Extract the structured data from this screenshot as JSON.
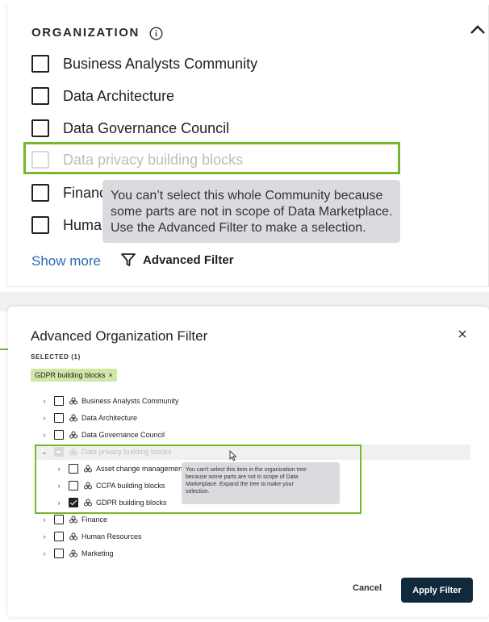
{
  "organization_panel": {
    "header": "ORGANIZATION",
    "items": [
      {
        "label": "Business Analysts Community"
      },
      {
        "label": "Data Architecture"
      },
      {
        "label": "Data Governance Council"
      },
      {
        "label": "Data privacy building blocks",
        "disabled": true
      },
      {
        "label": "Finance"
      },
      {
        "label": "Human Resources"
      }
    ],
    "tooltip_lines": [
      "You can’t select this whole Community because",
      "some parts are not in scope of Data Marketplace.",
      "Use the Advanced Filter to make a selection."
    ],
    "show_more": "Show more",
    "advanced_filter": "Advanced Filter"
  },
  "modal": {
    "title": "Advanced Organization Filter",
    "selected_label": "SELECTED (1)",
    "chip_label": "GDPR building blocks",
    "chip_close": "×",
    "close_icon": "×",
    "tree": [
      {
        "label": "Business Analysts Community",
        "caret": ">",
        "checked": false
      },
      {
        "label": "Data Architecture",
        "caret": ">",
        "checked": false
      },
      {
        "label": "Data Governance Council",
        "caret": ">",
        "checked": false
      },
      {
        "label": "Data privacy building blocks",
        "caret": "v",
        "state": "indeterminate",
        "disabled": true
      },
      {
        "label": "Asset change management",
        "caret": ">",
        "checked": false,
        "child": true
      },
      {
        "label": "CCPA building blocks",
        "caret": ">",
        "checked": false,
        "child": true
      },
      {
        "label": "GDPR building blocks",
        "caret": ">",
        "checked": true,
        "child": true
      },
      {
        "label": "Finance",
        "caret": ">",
        "checked": false
      },
      {
        "label": "Human Resources",
        "caret": ">",
        "checked": false
      },
      {
        "label": "Marketing",
        "caret": ">",
        "checked": false
      }
    ],
    "tooltip_lines": [
      "You can't select this item in the organization tree",
      "because some parts are not in scope of Data",
      "Marketplace. Expand the tree to make your",
      "selection."
    ],
    "cancel": "Cancel",
    "apply": "Apply Filter"
  },
  "colors": {
    "highlight": "#76b82a",
    "apply_button": "#0e2a3b",
    "link": "#2b6cb0",
    "chip": "#cfe8a6",
    "tooltip": "#d9dbde"
  }
}
